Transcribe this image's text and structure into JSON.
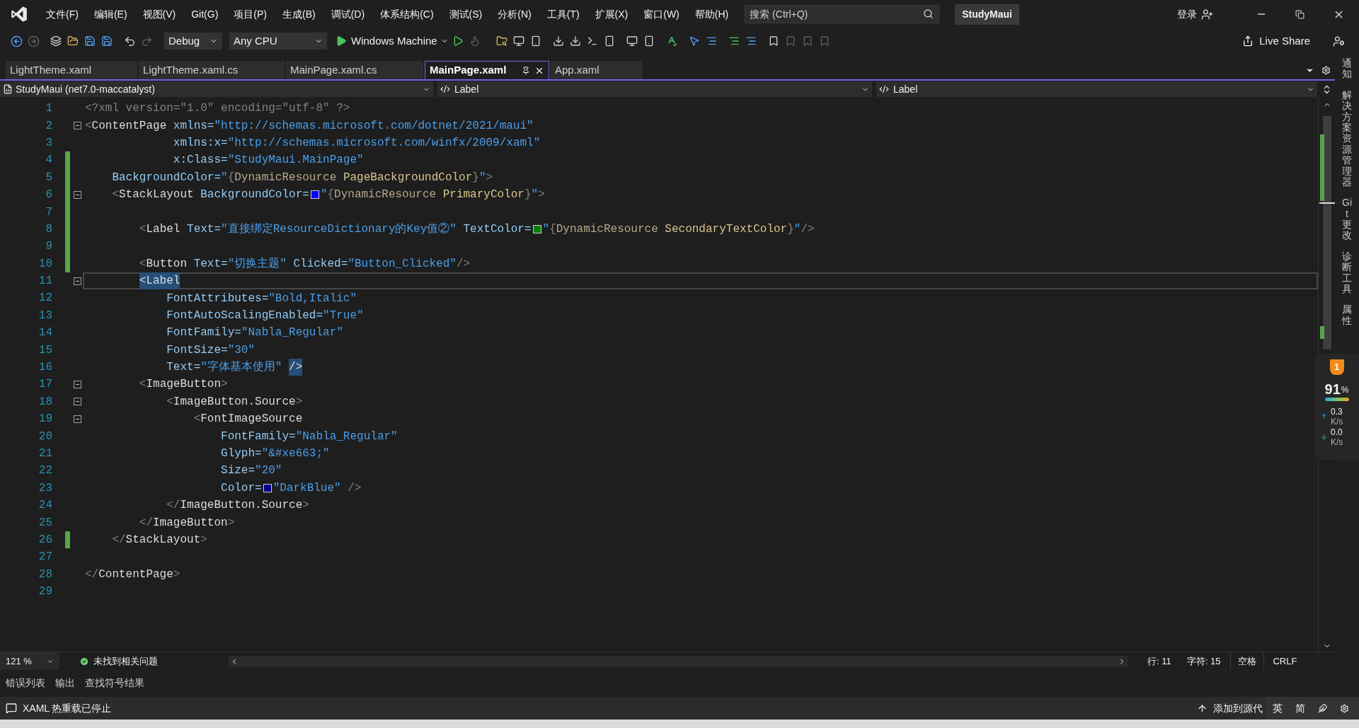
{
  "menu": [
    "文件(F)",
    "编辑(E)",
    "视图(V)",
    "Git(G)",
    "项目(P)",
    "生成(B)",
    "调试(D)",
    "体系结构(C)",
    "测试(S)",
    "分析(N)",
    "工具(T)",
    "扩展(X)",
    "窗口(W)",
    "帮助(H)"
  ],
  "search": {
    "placeholder": "搜索 (Ctrl+Q)"
  },
  "solution_name": "StudyMaui",
  "sign_in": "登录",
  "toolbar": {
    "configuration": "Debug",
    "platform": "Any CPU",
    "run_target": "Windows Machine",
    "live_share": "Live Share"
  },
  "tabs": [
    {
      "label": "LightTheme.xaml",
      "selected": false
    },
    {
      "label": "LightTheme.xaml.cs",
      "selected": false
    },
    {
      "label": "MainPage.xaml.cs",
      "selected": false
    },
    {
      "label": "MainPage.xaml",
      "selected": true
    },
    {
      "label": "App.xaml",
      "selected": false
    }
  ],
  "nav_bar": {
    "project": "StudyMaui (net7.0-maccatalyst)",
    "type": "Label",
    "member": "Label"
  },
  "code": {
    "lines": [
      {
        "number": "1",
        "changed": false,
        "foldable": false,
        "current": false,
        "tokens": [
          {
            "kind": "decl",
            "text": "<?xml version=\"1.0\" encoding=\"utf-8\" ?>"
          }
        ]
      },
      {
        "number": "2",
        "changed": false,
        "foldable": true,
        "current": false,
        "tokens": [
          {
            "kind": "punct",
            "text": "<"
          },
          {
            "kind": "element",
            "text": "ContentPage "
          },
          {
            "kind": "attr",
            "text": "xmlns="
          },
          {
            "kind": "string",
            "text": "\"http://schemas.microsoft.com/dotnet/2021/maui\""
          }
        ]
      },
      {
        "number": "3",
        "changed": false,
        "foldable": false,
        "current": false,
        "tokens": [
          {
            "kind": "attr",
            "text": "             xmlns:x="
          },
          {
            "kind": "string",
            "text": "\"http://schemas.microsoft.com/winfx/2009/xaml\""
          }
        ]
      },
      {
        "number": "4",
        "changed": true,
        "foldable": false,
        "current": false,
        "tokens": [
          {
            "kind": "attr",
            "text": "             x:Class="
          },
          {
            "kind": "string",
            "text": "\"StudyMaui.MainPage\""
          }
        ]
      },
      {
        "number": "5",
        "changed": true,
        "foldable": false,
        "current": false,
        "tokens": [
          {
            "kind": "attr",
            "text": "    BackgroundColor="
          },
          {
            "kind": "string",
            "text": "\""
          },
          {
            "kind": "punct",
            "text": "{"
          },
          {
            "kind": "markup",
            "text": "DynamicResource "
          },
          {
            "kind": "resource",
            "text": "PageBackgroundColor"
          },
          {
            "kind": "punct",
            "text": "}"
          },
          {
            "kind": "string",
            "text": "\""
          },
          {
            "kind": "punct",
            "text": ">"
          }
        ]
      },
      {
        "number": "6",
        "changed": true,
        "foldable": true,
        "current": false,
        "tokens": [
          {
            "kind": "punct",
            "text": "    <"
          },
          {
            "kind": "element",
            "text": "StackLayout "
          },
          {
            "kind": "attr",
            "text": "BackgroundColor="
          },
          {
            "kind": "swatch",
            "color": "#0000ff"
          },
          {
            "kind": "string",
            "text": "\""
          },
          {
            "kind": "punct",
            "text": "{"
          },
          {
            "kind": "markup",
            "text": "DynamicResource "
          },
          {
            "kind": "resource",
            "text": "PrimaryColor"
          },
          {
            "kind": "punct",
            "text": "}"
          },
          {
            "kind": "string",
            "text": "\""
          },
          {
            "kind": "punct",
            "text": ">"
          }
        ]
      },
      {
        "number": "7",
        "changed": true,
        "foldable": false,
        "current": false
      },
      {
        "number": "8",
        "changed": true,
        "foldable": false,
        "current": false,
        "tokens": [
          {
            "kind": "punct",
            "text": "        <"
          },
          {
            "kind": "element",
            "text": "Label "
          },
          {
            "kind": "attr",
            "text": "Text="
          },
          {
            "kind": "string",
            "text": "\"直接绑定ResourceDictionary的Key值②\""
          },
          {
            "kind": "attr",
            "text": " TextColor="
          },
          {
            "kind": "swatch",
            "color": "#008000"
          },
          {
            "kind": "string",
            "text": "\""
          },
          {
            "kind": "punct",
            "text": "{"
          },
          {
            "kind": "markup",
            "text": "DynamicResource "
          },
          {
            "kind": "resource",
            "text": "SecondaryTextColor"
          },
          {
            "kind": "punct",
            "text": "}"
          },
          {
            "kind": "string",
            "text": "\""
          },
          {
            "kind": "punct",
            "text": "/>"
          }
        ]
      },
      {
        "number": "9",
        "changed": true,
        "foldable": false,
        "current": false
      },
      {
        "number": "10",
        "changed": true,
        "foldable": false,
        "current": false,
        "tokens": [
          {
            "kind": "punct",
            "text": "        <"
          },
          {
            "kind": "element",
            "text": "Button "
          },
          {
            "kind": "attr",
            "text": "Text="
          },
          {
            "kind": "string",
            "text": "\"切换主题\""
          },
          {
            "kind": "attr",
            "text": " Clicked="
          },
          {
            "kind": "string",
            "text": "\"Button_Clicked\""
          },
          {
            "kind": "punct",
            "text": "/>"
          }
        ]
      },
      {
        "number": "11",
        "changed": false,
        "foldable": true,
        "current": true,
        "tokens": [
          {
            "kind": "selection",
            "text": "        <Label"
          }
        ]
      },
      {
        "number": "12",
        "changed": false,
        "foldable": false,
        "current": false,
        "tokens": [
          {
            "kind": "attr",
            "text": "            FontAttributes="
          },
          {
            "kind": "string",
            "text": "\"Bold,Italic\""
          }
        ]
      },
      {
        "number": "13",
        "changed": false,
        "foldable": false,
        "current": false,
        "tokens": [
          {
            "kind": "attr",
            "text": "            FontAutoScalingEnabled="
          },
          {
            "kind": "string",
            "text": "\"True\""
          }
        ]
      },
      {
        "number": "14",
        "changed": false,
        "foldable": false,
        "current": false,
        "tokens": [
          {
            "kind": "attr",
            "text": "            FontFamily="
          },
          {
            "kind": "string",
            "text": "\"Nabla_Regular\""
          }
        ]
      },
      {
        "number": "15",
        "changed": false,
        "foldable": false,
        "current": false,
        "tokens": [
          {
            "kind": "attr",
            "text": "            FontSize="
          },
          {
            "kind": "string",
            "text": "\"30\""
          }
        ]
      },
      {
        "number": "16",
        "changed": false,
        "foldable": false,
        "current": false,
        "tokens": [
          {
            "kind": "attr",
            "text": "            Text="
          },
          {
            "kind": "string",
            "text": "\"字体基本使用\" "
          },
          {
            "kind": "selection",
            "text": "/>"
          }
        ]
      },
      {
        "number": "17",
        "changed": false,
        "foldable": true,
        "current": false,
        "tokens": [
          {
            "kind": "punct",
            "text": "        <"
          },
          {
            "kind": "element",
            "text": "ImageButton"
          },
          {
            "kind": "punct",
            "text": ">"
          }
        ]
      },
      {
        "number": "18",
        "changed": false,
        "foldable": true,
        "current": false,
        "tokens": [
          {
            "kind": "punct",
            "text": "            <"
          },
          {
            "kind": "element",
            "text": "ImageButton.Source"
          },
          {
            "kind": "punct",
            "text": ">"
          }
        ]
      },
      {
        "number": "19",
        "changed": false,
        "foldable": true,
        "current": false,
        "tokens": [
          {
            "kind": "punct",
            "text": "                <"
          },
          {
            "kind": "element",
            "text": "FontImageSource"
          }
        ]
      },
      {
        "number": "20",
        "changed": false,
        "foldable": false,
        "current": false,
        "tokens": [
          {
            "kind": "attr",
            "text": "                    FontFamily="
          },
          {
            "kind": "string",
            "text": "\"Nabla_Regular\""
          }
        ]
      },
      {
        "number": "21",
        "changed": false,
        "foldable": false,
        "current": false,
        "tokens": [
          {
            "kind": "attr",
            "text": "                    Glyph="
          },
          {
            "kind": "string",
            "text": "\"&#xe663;\""
          }
        ]
      },
      {
        "number": "22",
        "changed": false,
        "foldable": false,
        "current": false,
        "tokens": [
          {
            "kind": "attr",
            "text": "                    Size="
          },
          {
            "kind": "string",
            "text": "\"20\""
          }
        ]
      },
      {
        "number": "23",
        "changed": false,
        "foldable": false,
        "current": false,
        "tokens": [
          {
            "kind": "attr",
            "text": "                    Color="
          },
          {
            "kind": "swatch",
            "color": "#00008b"
          },
          {
            "kind": "string",
            "text": "\"DarkBlue\""
          },
          {
            "kind": "punct",
            "text": " />"
          }
        ]
      },
      {
        "number": "24",
        "changed": false,
        "foldable": false,
        "current": false,
        "tokens": [
          {
            "kind": "punct",
            "text": "            </"
          },
          {
            "kind": "element",
            "text": "ImageButton.Source"
          },
          {
            "kind": "punct",
            "text": ">"
          }
        ]
      },
      {
        "number": "25",
        "changed": false,
        "foldable": false,
        "current": false,
        "tokens": [
          {
            "kind": "punct",
            "text": "        </"
          },
          {
            "kind": "element",
            "text": "ImageButton"
          },
          {
            "kind": "punct",
            "text": ">"
          }
        ]
      },
      {
        "number": "26",
        "changed": true,
        "foldable": false,
        "current": false,
        "tokens": [
          {
            "kind": "punct",
            "text": "    </"
          },
          {
            "kind": "element",
            "text": "StackLayout"
          },
          {
            "kind": "punct",
            "text": ">"
          }
        ]
      },
      {
        "number": "27",
        "changed": false,
        "foldable": false,
        "current": false
      },
      {
        "number": "28",
        "changed": false,
        "foldable": false,
        "current": false,
        "tokens": [
          {
            "kind": "punct",
            "text": "</"
          },
          {
            "kind": "element",
            "text": "ContentPage"
          },
          {
            "kind": "punct",
            "text": ">"
          }
        ]
      },
      {
        "number": "29",
        "changed": false,
        "foldable": false,
        "current": false
      }
    ]
  },
  "editor_status": {
    "zoom": "121 %",
    "issues": "未找到相关问题",
    "line": "行: 11",
    "column": "字符: 15",
    "whitespace": "空格",
    "line_ending": "CRLF"
  },
  "tool_tabs": [
    "错误列表",
    "输出",
    "查找符号结果"
  ],
  "side_tabs": [
    "通知",
    "解决方案资源管理器",
    "Git 更改",
    "诊断工具",
    "属性"
  ],
  "monitor": {
    "alerts": "1",
    "percent": "91",
    "percent_unit": "%",
    "upload": "0.3",
    "upload_unit": "K/s",
    "download": "0.0",
    "download_unit": "K/s"
  },
  "status_bar": {
    "hot_reload": "XAML 热重载已停止",
    "source_control": "添加到源代",
    "ime": [
      "英",
      "简"
    ]
  }
}
